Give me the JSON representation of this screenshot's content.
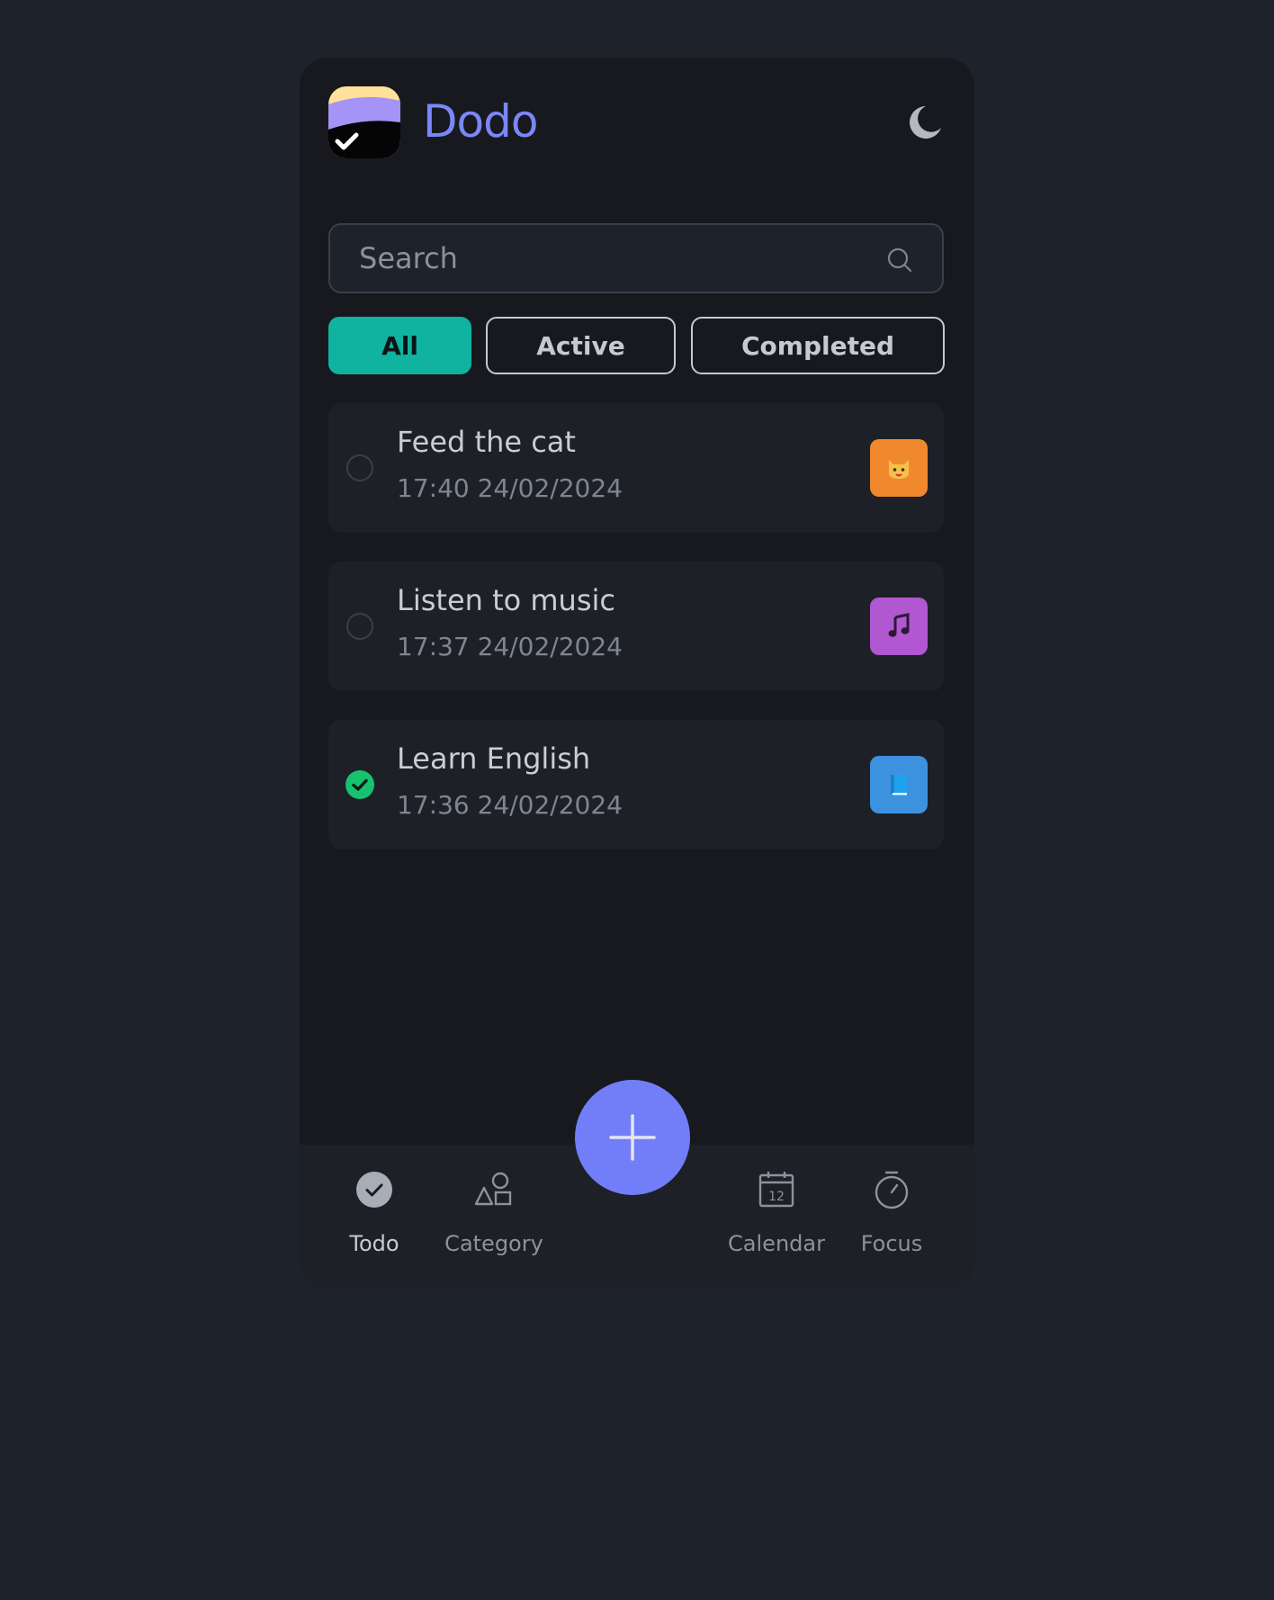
{
  "app": {
    "title": "Dodo",
    "accent_color": "#7b86f9"
  },
  "header": {
    "theme_toggle_icon": "moon-icon"
  },
  "search": {
    "placeholder": "Search",
    "value": "",
    "icon": "search-icon"
  },
  "filters": [
    {
      "label": "All",
      "selected": true,
      "color": "#0fb3a0"
    },
    {
      "label": "Active",
      "selected": false
    },
    {
      "label": "Completed",
      "selected": false
    }
  ],
  "tasks": [
    {
      "name": "Feed the cat",
      "time": "17:40 24/02/2024",
      "completed": false,
      "category_icon": "cat-face-icon",
      "category_color": "#f0892d"
    },
    {
      "name": "Listen to music",
      "time": "17:37 24/02/2024",
      "completed": false,
      "category_icon": "music-note-icon",
      "category_color": "#b257d2"
    },
    {
      "name": "Learn English",
      "time": "17:36 24/02/2024",
      "completed": true,
      "category_icon": "book-icon",
      "category_color": "#3d92df"
    }
  ],
  "fab": {
    "icon": "plus-icon",
    "color": "#727ef8"
  },
  "nav": [
    {
      "label": "Todo",
      "icon": "check-circle-icon",
      "selected": true
    },
    {
      "label": "Category",
      "icon": "shapes-icon",
      "selected": false
    },
    {
      "label": "Calendar",
      "icon": "calendar-icon",
      "selected": false,
      "icon_text": "12"
    },
    {
      "label": "Focus",
      "icon": "stopwatch-icon",
      "selected": false
    }
  ]
}
